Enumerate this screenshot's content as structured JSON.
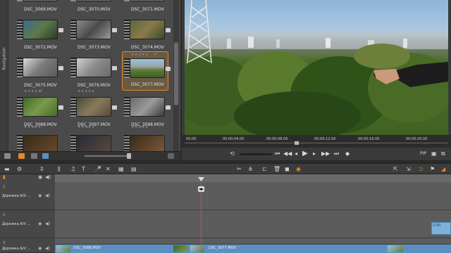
{
  "library": {
    "nav_label": "Navigation",
    "clips": [
      {
        "name": "DSC_3069.MOV",
        "stars": "",
        "thumb": "linear-gradient(#999,#777)"
      },
      {
        "name": "DSC_3070.MOV",
        "stars": "",
        "thumb": "linear-gradient(#999,#777)"
      },
      {
        "name": "DSC_3071.MOV",
        "stars": "",
        "thumb": "linear-gradient(#999,#777)"
      },
      {
        "name": "DSC_3072.MOV",
        "stars": "",
        "thumb": "linear-gradient(135deg,#3f6a8f,#5c7a4a 50%,#2a3a28)"
      },
      {
        "name": "DSC_3073.MOV",
        "stars": "",
        "thumb": "linear-gradient(135deg,#8a8a8a,#4a4a4a 50%,#999)"
      },
      {
        "name": "DSC_3074.MOV",
        "stars": "",
        "thumb": "linear-gradient(135deg,#5a6a3a,#8a7a4a 50%,#3a4a2a)"
      },
      {
        "name": "DSC_3075.MOV",
        "stars": "★★★★★",
        "thumb": "linear-gradient(135deg,#dcdcdc,#7a7a7a 50%,#5a5a5a)"
      },
      {
        "name": "DSC_3076.MOV",
        "stars": "★★★★★",
        "thumb": "linear-gradient(135deg,#cfcfcf,#8a8a8a 50%,#6a6a6a)"
      },
      {
        "name": "DSC_3077.MOV",
        "stars": "★★★★★",
        "thumb": "linear-gradient(180deg,#9cc0de 0%,#9aa6a8 40%,#5e7d3a 60%,#3e5d22)"
      },
      {
        "name": "DSC_3088.MOV",
        "stars": "★★★★★",
        "thumb": "linear-gradient(135deg,#3d6a2a,#7a9a4a 50%,#4a6a2a)"
      },
      {
        "name": "DSC_3097.MOV",
        "stars": "★★★★★",
        "thumb": "linear-gradient(135deg,#4a4a3a,#8a7a5a 50%,#5a4a3a)"
      },
      {
        "name": "DSC_3098.MOV",
        "stars": "★★★★★",
        "thumb": "linear-gradient(135deg,#6a6a6a,#9a9a9a 50%,#3a3a3a)"
      },
      {
        "name": "",
        "stars": "",
        "thumb": "linear-gradient(135deg,#3a2a1a,#6a4a2a)"
      },
      {
        "name": "",
        "stars": "",
        "thumb": "linear-gradient(135deg,#2a2a3a,#5a4a3a)"
      },
      {
        "name": "",
        "stars": "",
        "thumb": "linear-gradient(135deg,#3a2a1a,#7a5a3a)"
      }
    ],
    "selected_check": "✓"
  },
  "player": {
    "ruler_times": [
      "00:00",
      "00:00:04.00",
      "00:00:08.00",
      "00:00:12.00",
      "00:00:16.00",
      "00:00:20.00"
    ],
    "pip_label": "PIP"
  },
  "timeline": {
    "tracks": [
      {
        "num": "1",
        "name": "Дорожка A/V ..."
      },
      {
        "num": "2",
        "name": "Дорожка A/V ..."
      },
      {
        "num": "3",
        "name": "Дорожка A/V ..."
      }
    ],
    "clips": [
      {
        "name": "DSC_3088.MOV"
      },
      {
        "name": "DSC_3077.MOV"
      }
    ],
    "zoom_label": "1:00",
    "accent_color": "#e3892b"
  }
}
